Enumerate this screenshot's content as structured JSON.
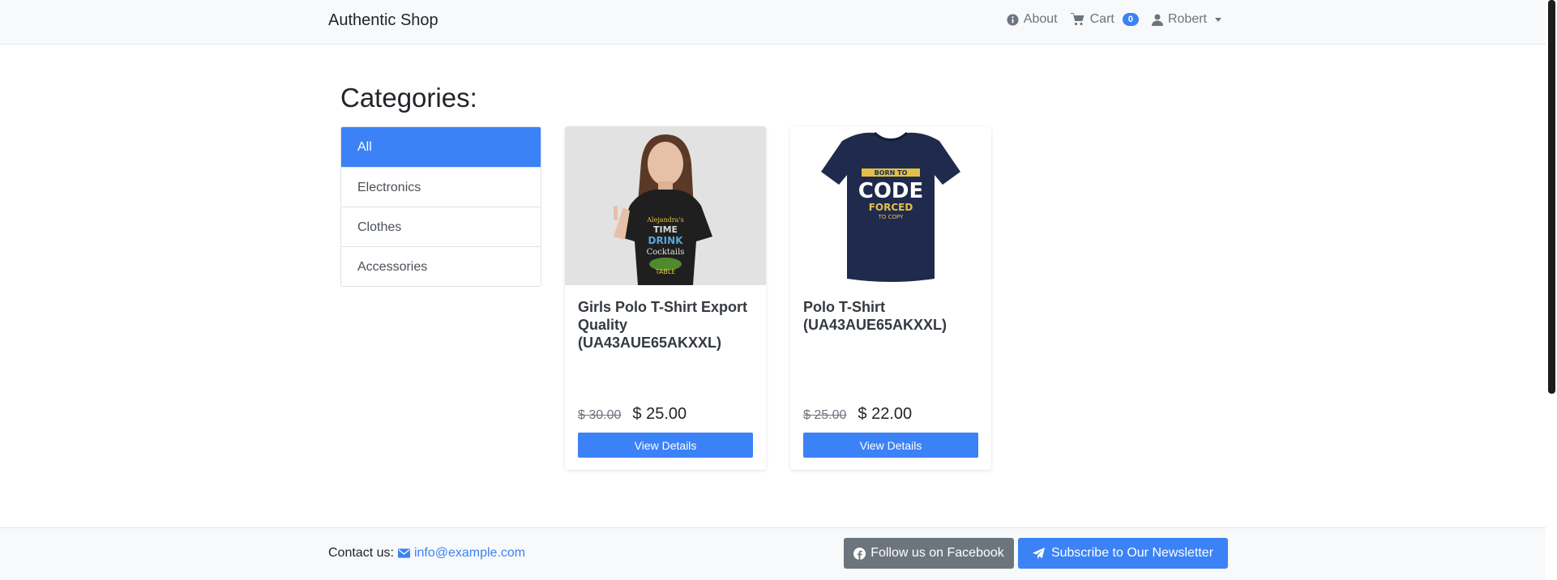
{
  "navbar": {
    "brand": "Authentic Shop",
    "about_label": "About",
    "cart_label": "Cart",
    "cart_count": "0",
    "user_label": "Robert"
  },
  "main": {
    "title": "Categories:",
    "categories": [
      {
        "label": "All",
        "active": true
      },
      {
        "label": "Electronics",
        "active": false
      },
      {
        "label": "Clothes",
        "active": false
      },
      {
        "label": "Accessories",
        "active": false
      }
    ],
    "products": [
      {
        "title": "Girls Polo T-Shirt Export Quality (UA43AUE65AKXXL)",
        "old_price": "$ 30.00",
        "price": "$ 25.00",
        "button": "View Details",
        "shirt_text": [
          "Alejandra's",
          "TIME",
          "DRINK",
          "Cocktails",
          "TABLE"
        ]
      },
      {
        "title": "Polo T-Shirt (UA43AUE65AKXXL)",
        "old_price": "$ 25.00",
        "price": "$ 22.00",
        "button": "View Details",
        "shirt_text": [
          "BORN TO",
          "CODE",
          "FORCED",
          "TO COPY"
        ]
      }
    ]
  },
  "footer": {
    "contact_label": "Contact us:",
    "email": "info@example.com",
    "facebook_button": "Follow us on Facebook",
    "newsletter_button": "Subscribe to Our Newsletter"
  },
  "colors": {
    "primary": "#3b82f6",
    "secondary": "#6c757d",
    "navbar_bg": "#f8f9fa"
  },
  "icons": {
    "about": "info-circle-icon",
    "cart": "shopping-cart-icon",
    "user": "user-icon",
    "email": "envelope-icon",
    "facebook": "facebook-icon",
    "newsletter": "paper-plane-icon"
  }
}
